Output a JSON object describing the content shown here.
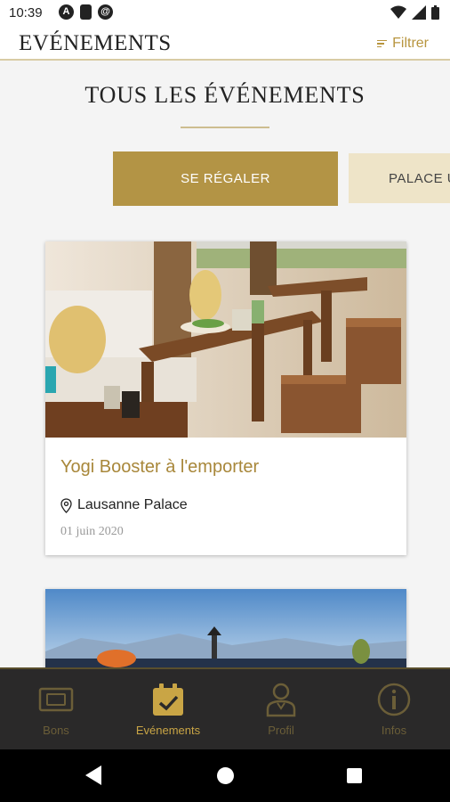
{
  "status_bar": {
    "time": "10:39"
  },
  "header": {
    "title": "EVÉNEMENTS",
    "filter_label": "Filtrer"
  },
  "section": {
    "title": "TOUS LES ÉVÉNEMENTS"
  },
  "chips": [
    {
      "label": "SE RÉGALER",
      "active": true
    },
    {
      "label": "PALACE U",
      "active": false
    }
  ],
  "events": [
    {
      "title": "Yogi Booster à l'emporter",
      "location": "Lausanne Palace",
      "date": "01 juin 2020"
    }
  ],
  "bottom_nav": [
    {
      "label": "Bons",
      "icon": "ticket-icon",
      "active": false
    },
    {
      "label": "Evénements",
      "icon": "calendar-check-icon",
      "active": true
    },
    {
      "label": "Profil",
      "icon": "user-icon",
      "active": false
    },
    {
      "label": "Infos",
      "icon": "info-icon",
      "active": false
    }
  ],
  "colors": {
    "accent": "#b39445",
    "nav_bg": "#2a2929",
    "chip_inactive": "#eee4c8"
  }
}
